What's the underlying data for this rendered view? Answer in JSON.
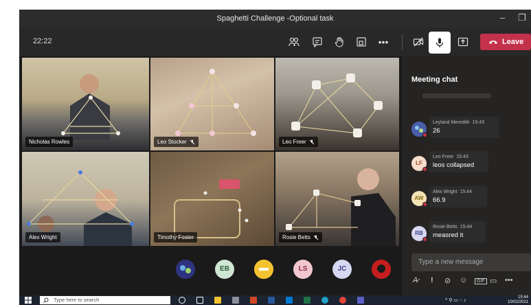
{
  "window": {
    "title": "Spaghetti Challenge -Optional task"
  },
  "toolbar": {
    "elapsed": "22:22",
    "leave_label": "Leave"
  },
  "participants": [
    {
      "name": "Nicholas Rowles",
      "muted": false
    },
    {
      "name": "Leo Stocker",
      "muted": true
    },
    {
      "name": "Leo Freer",
      "muted": true
    },
    {
      "name": "Alex Wright",
      "muted": false
    },
    {
      "name": "Timothy Foster",
      "muted": false
    },
    {
      "name": "Rosie Betts",
      "muted": true
    }
  ],
  "overflow_avatars": [
    {
      "initials": "",
      "kind": "photo",
      "color": "#3a3d8a"
    },
    {
      "initials": "EB",
      "kind": "initials",
      "color": "#cfe6d3",
      "text_color": "#2e5a3a"
    },
    {
      "initials": "",
      "kind": "logo",
      "color": "#f2c230"
    },
    {
      "initials": "LS",
      "kind": "initials",
      "color": "#f1c6cf",
      "text_color": "#8a2c44"
    },
    {
      "initials": "JC",
      "kind": "initials",
      "color": "#d6d7f0",
      "text_color": "#3e3f8a"
    },
    {
      "initials": "",
      "kind": "logo",
      "color": "#c41e1e"
    }
  ],
  "chat": {
    "heading": "Meeting chat",
    "messages": [
      {
        "author": "Leyland Meredith",
        "time": "15:43",
        "text": "26",
        "avatar": "",
        "avatar_bg": "#4a5fa8",
        "avatar_fg": "#fff"
      },
      {
        "author": "Leo Freer",
        "time": "15:43",
        "text": "leos collapsed",
        "avatar": "LF",
        "avatar_bg": "#f6dccb",
        "avatar_fg": "#9a4b1e"
      },
      {
        "author": "Alex Wright",
        "time": "15:44",
        "text": "66.9",
        "avatar": "AW",
        "avatar_bg": "#f3e3b5",
        "avatar_fg": "#8a6b12"
      },
      {
        "author": "Rosie Betts",
        "time": "15:44",
        "text": "measred it",
        "avatar": "RB",
        "avatar_bg": "#d7d8f0",
        "avatar_fg": "#3e3f8a"
      }
    ],
    "compose_placeholder": "Type a new message",
    "tools": [
      "format-icon",
      "important-icon",
      "attach-icon",
      "emoji-icon",
      "gif-icon",
      "sticker-icon",
      "more-icon"
    ]
  },
  "taskbar": {
    "search_placeholder": "Type here to search",
    "time": "15:44",
    "date": "10/02/2021"
  },
  "colors": {
    "accent_leave": "#c4314b",
    "app_bg": "#1f1f1f",
    "chat_bg": "#252423"
  }
}
